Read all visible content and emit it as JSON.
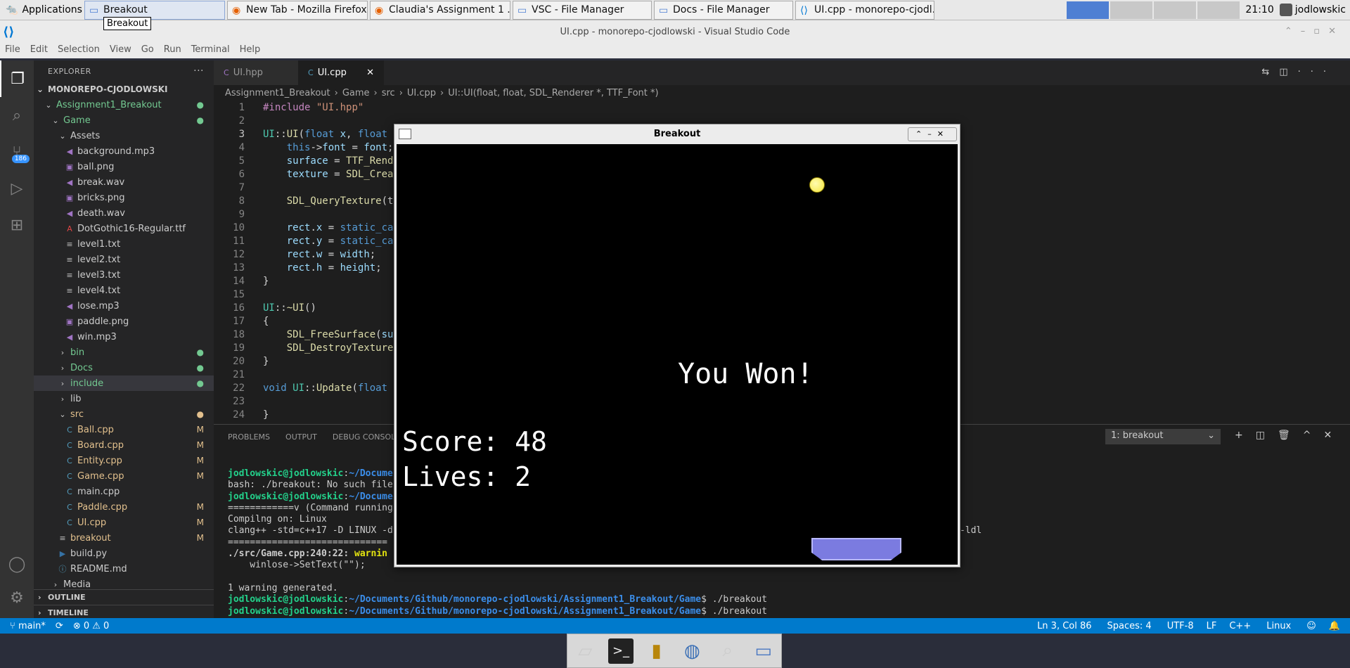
{
  "taskbar": {
    "applications": "Applications",
    "windows": [
      {
        "label": "Breakout",
        "active": true
      },
      {
        "label": "New Tab - Mozilla Firefox"
      },
      {
        "label": "Claudia's Assignment 1 ..."
      },
      {
        "label": "VSC - File Manager"
      },
      {
        "label": "Docs - File Manager"
      },
      {
        "label": "UI.cpp - monorepo-cjodl..."
      }
    ],
    "tooltip": "Breakout",
    "clock": "21:10",
    "user": "jodlowskic"
  },
  "vscode": {
    "title": "UI.cpp - monorepo-cjodlowski - Visual Studio Code",
    "menu": [
      "File",
      "Edit",
      "Selection",
      "View",
      "Go",
      "Run",
      "Terminal",
      "Help"
    ],
    "scm_badge": "186",
    "explorer": {
      "header": "EXPLORER",
      "root": "MONOREPO-CJODLOWSKI",
      "rows": [
        {
          "label": "Assignment1_Breakout",
          "indent": 1,
          "kind": "folder-open",
          "cls": "green",
          "mark": "●"
        },
        {
          "label": "Game",
          "indent": 2,
          "kind": "folder-open",
          "cls": "green",
          "mark": "●"
        },
        {
          "label": "Assets",
          "indent": 3,
          "kind": "folder-open",
          "cls": "",
          "mark": ""
        },
        {
          "label": "background.mp3",
          "indent": 4,
          "kind": "audio",
          "cls": "",
          "mark": ""
        },
        {
          "label": "ball.png",
          "indent": 4,
          "kind": "image",
          "cls": "",
          "mark": ""
        },
        {
          "label": "break.wav",
          "indent": 4,
          "kind": "audio",
          "cls": "",
          "mark": ""
        },
        {
          "label": "bricks.png",
          "indent": 4,
          "kind": "image",
          "cls": "",
          "mark": ""
        },
        {
          "label": "death.wav",
          "indent": 4,
          "kind": "audio",
          "cls": "",
          "mark": ""
        },
        {
          "label": "DotGothic16-Regular.ttf",
          "indent": 4,
          "kind": "font",
          "cls": "",
          "mark": ""
        },
        {
          "label": "level1.txt",
          "indent": 4,
          "kind": "text",
          "cls": "",
          "mark": ""
        },
        {
          "label": "level2.txt",
          "indent": 4,
          "kind": "text",
          "cls": "",
          "mark": ""
        },
        {
          "label": "level3.txt",
          "indent": 4,
          "kind": "text",
          "cls": "",
          "mark": ""
        },
        {
          "label": "level4.txt",
          "indent": 4,
          "kind": "text",
          "cls": "",
          "mark": ""
        },
        {
          "label": "lose.mp3",
          "indent": 4,
          "kind": "audio",
          "cls": "",
          "mark": ""
        },
        {
          "label": "paddle.png",
          "indent": 4,
          "kind": "image",
          "cls": "",
          "mark": ""
        },
        {
          "label": "win.mp3",
          "indent": 4,
          "kind": "audio",
          "cls": "",
          "mark": ""
        },
        {
          "label": "bin",
          "indent": 3,
          "kind": "folder",
          "cls": "green",
          "mark": "●"
        },
        {
          "label": "Docs",
          "indent": 3,
          "kind": "folder",
          "cls": "green",
          "mark": "●"
        },
        {
          "label": "include",
          "indent": 3,
          "kind": "folder",
          "cls": "green",
          "mark": "●",
          "selected": true
        },
        {
          "label": "lib",
          "indent": 3,
          "kind": "folder",
          "cls": "",
          "mark": ""
        },
        {
          "label": "src",
          "indent": 3,
          "kind": "folder-open",
          "cls": "yellow",
          "mark": "●"
        },
        {
          "label": "Ball.cpp",
          "indent": 4,
          "kind": "cpp",
          "cls": "yellow",
          "mark": "M"
        },
        {
          "label": "Board.cpp",
          "indent": 4,
          "kind": "cpp",
          "cls": "yellow",
          "mark": "M"
        },
        {
          "label": "Entity.cpp",
          "indent": 4,
          "kind": "cpp",
          "cls": "yellow",
          "mark": "M"
        },
        {
          "label": "Game.cpp",
          "indent": 4,
          "kind": "cpp",
          "cls": "yellow",
          "mark": "M"
        },
        {
          "label": "main.cpp",
          "indent": 4,
          "kind": "cpp",
          "cls": "",
          "mark": ""
        },
        {
          "label": "Paddle.cpp",
          "indent": 4,
          "kind": "cpp",
          "cls": "yellow",
          "mark": "M"
        },
        {
          "label": "UI.cpp",
          "indent": 4,
          "kind": "cpp",
          "cls": "yellow",
          "mark": "M"
        },
        {
          "label": "breakout",
          "indent": 3,
          "kind": "text",
          "cls": "yellow",
          "mark": "M"
        },
        {
          "label": "build.py",
          "indent": 3,
          "kind": "python",
          "cls": "",
          "mark": ""
        },
        {
          "label": "README.md",
          "indent": 3,
          "kind": "info",
          "cls": "",
          "mark": ""
        },
        {
          "label": "Media",
          "indent": 2,
          "kind": "folder",
          "cls": "",
          "mark": ""
        }
      ],
      "outline": "OUTLINE",
      "timeline": "TIMELINE"
    },
    "tabs": [
      {
        "label": "UI.hpp",
        "active": false
      },
      {
        "label": "UI.cpp",
        "active": true
      }
    ],
    "breadcrumbs": [
      "Assignment1_Breakout",
      "Game",
      "src",
      "UI.cpp",
      "UI::UI(float, float, SDL_Renderer *, TTF_Font *)"
    ],
    "code_lines": [
      {
        "n": "1",
        "html": "<span class='pp'>#include</span> <span class='str'>\"UI.hpp\"</span>"
      },
      {
        "n": "2",
        "html": ""
      },
      {
        "n": "3",
        "html": "<span class='ty'>UI</span>::<span class='fn'>UI</span>(<span class='kw'>float</span> <span class='vr'>x</span>, <span class='kw'>float</span>"
      },
      {
        "n": "4",
        "html": "    <span class='kw'>this</span>-><span class='vr'>font</span> = <span class='vr'>font</span>;"
      },
      {
        "n": "5",
        "html": "    <span class='vr'>surface</span> = <span class='fn'>TTF_Rend</span>"
      },
      {
        "n": "6",
        "html": "    <span class='vr'>texture</span> = <span class='fn'>SDL_Crea</span>"
      },
      {
        "n": "7",
        "html": ""
      },
      {
        "n": "8",
        "html": "    <span class='fn'>SDL_QueryTexture</span>(t"
      },
      {
        "n": "9",
        "html": ""
      },
      {
        "n": "10",
        "html": "    <span class='vr'>rect</span>.<span class='vr'>x</span> = <span class='kw'>static_ca</span>"
      },
      {
        "n": "11",
        "html": "    <span class='vr'>rect</span>.<span class='vr'>y</span> = <span class='kw'>static_ca</span>"
      },
      {
        "n": "12",
        "html": "    <span class='vr'>rect</span>.<span class='vr'>w</span> = <span class='vr'>width</span>;"
      },
      {
        "n": "13",
        "html": "    <span class='vr'>rect</span>.<span class='vr'>h</span> = <span class='vr'>height</span>;"
      },
      {
        "n": "14",
        "html": "}"
      },
      {
        "n": "15",
        "html": ""
      },
      {
        "n": "16",
        "html": "<span class='ty'>UI</span>::<span class='fn'>~UI</span>()"
      },
      {
        "n": "17",
        "html": "{"
      },
      {
        "n": "18",
        "html": "    <span class='fn'>SDL_FreeSurface</span>(<span class='vr'>su</span>"
      },
      {
        "n": "19",
        "html": "    <span class='fn'>SDL_DestroyTexture</span>"
      },
      {
        "n": "20",
        "html": "}"
      },
      {
        "n": "21",
        "html": ""
      },
      {
        "n": "22",
        "html": "<span class='kw'>void</span> <span class='ty'>UI</span>::<span class='fn'>Update</span>(<span class='kw'>float</span>"
      },
      {
        "n": "23",
        "html": ""
      },
      {
        "n": "24",
        "html": "}"
      }
    ],
    "panel": {
      "tabs": [
        "PROBLEMS",
        "OUTPUT",
        "DEBUG CONSOLE"
      ],
      "terminal_select": "1: breakout",
      "terminal_html": "<span class='tg'>jodlowskic@jodlowskic</span>:<span class='tb'>~/Docume</span>\nbash: ./breakout: No such file\n<span class='tg'>jodlowskic@jodlowskic</span>:<span class='tb'>~/Docume</span>\n============v (Command running\nCompilng on: Linux\nclang++ -std=c++17 -D LINUX -d                                                                                           lSDL2_mixer -ldl\n=============================\n<b>./src/Game.cpp:240:22: </b><span class='tw'>warnin</span>\n    winlose->SetText(\"\");\n\n1 warning generated.\n<span class='tg'>jodlowskic@jodlowskic</span>:<span class='tb'>~/Documents/Github/monorepo-cjodlowski/Assignment1_Breakout/Game</span>$ ./breakout\n<span class='tg'>jodlowskic@jodlowskic</span>:<span class='tb'>~/Documents/Github/monorepo-cjodlowski/Assignment1_Breakout/Game</span>$ ./breakout\n▯"
    },
    "status": {
      "branch": "main*",
      "problems": "⊗ 0 ⚠ 0",
      "position": "Ln 3, Col 86",
      "spaces": "Spaces: 4",
      "encoding": "UTF-8",
      "eol": "LF",
      "language": "C++",
      "os": "Linux"
    }
  },
  "game": {
    "title": "Breakout",
    "message": "You Won!",
    "score": "Score: 48",
    "lives": "Lives: 2",
    "ball_color": "#f5e63a",
    "paddle_color": "#7b7be0"
  }
}
